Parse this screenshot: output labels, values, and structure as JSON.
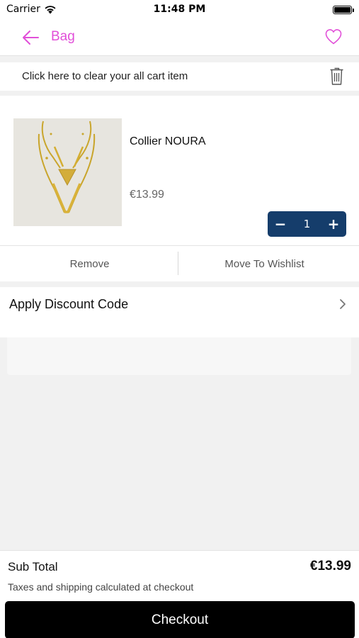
{
  "status_bar": {
    "carrier": "Carrier",
    "time": "11:48 PM",
    "icons": [
      "wifi-icon",
      "battery-icon"
    ]
  },
  "header": {
    "title": "Bag",
    "back_icon": "arrow-left-icon",
    "wishlist_icon": "heart-icon",
    "accent_color": "#e14fd8"
  },
  "clear_cart": {
    "text": "Click here to clear your all cart item",
    "icon": "trash-icon"
  },
  "cart": {
    "items": [
      {
        "name": "Collier NOURA",
        "price": "€13.99",
        "quantity": "1",
        "decrement_label": "−",
        "increment_label": "+",
        "image": "necklace-image"
      }
    ],
    "remove_label": "Remove",
    "move_to_wishlist_label": "Move To Wishlist",
    "stepper_color": "#153d6b"
  },
  "discount": {
    "label": "Apply Discount Code",
    "icon": "chevron-right-icon"
  },
  "footer": {
    "subtotal_label": "Sub Total",
    "subtotal_value": "€13.99",
    "tax_note": "Taxes and shipping calculated at checkout",
    "checkout_label": "Checkout"
  }
}
